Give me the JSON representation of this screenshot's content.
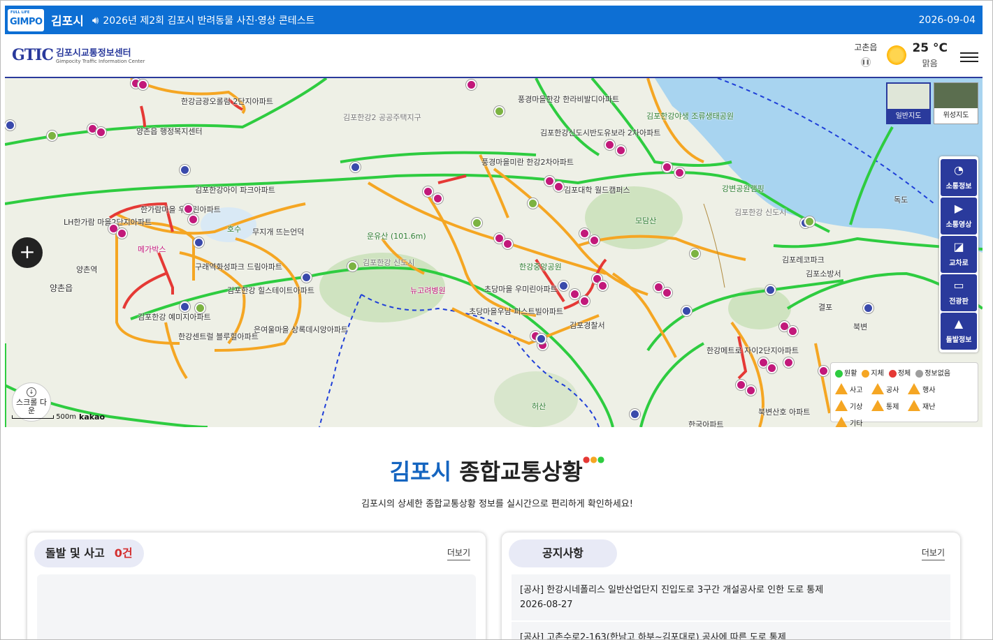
{
  "topbar": {
    "logo_top": "FULL LIFE",
    "logo_main": "GIMPO",
    "city": "김포시",
    "notice": "2026년 제2회 김포시 반려동물 사진·영상 콘테스트",
    "date": "2026-09-04",
    "background": "#0d6fd4"
  },
  "header": {
    "brand_mark": "GTIC",
    "brand_name": "김포시교통정보센터",
    "brand_sub": "Gimpocity Traffic Information Center",
    "weather_area": "고촌읍",
    "temperature": "25 °C",
    "condition": "맑음",
    "icons": [
      "sun-icon",
      "pause-icon",
      "menu-icon"
    ]
  },
  "map": {
    "maptypes": [
      "일반지도",
      "위성지도"
    ],
    "side_buttons": [
      "소통정보",
      "소통영상",
      "교차로",
      "전광판",
      "돌발정보"
    ],
    "zoom_label": "+",
    "scroll_label": "스크롤 다운",
    "scale": "500m",
    "provider": "kakao",
    "legend": {
      "traffic": [
        {
          "label": "원활",
          "color": "#2ecc40"
        },
        {
          "label": "지체",
          "color": "#f5a623"
        },
        {
          "label": "정체",
          "color": "#e53935"
        },
        {
          "label": "정보없음",
          "color": "#9e9e9e"
        }
      ],
      "events": [
        "사고",
        "공사",
        "행사",
        "기상",
        "통제",
        "재난",
        "기타"
      ]
    },
    "places": [
      "한강금광오롤림 2단지아파트",
      "김포한강2 공공주택지구",
      "풍경마을한강 한라비발디아파트",
      "김포한강야생 조류생태공원",
      "양촌읍 행정복지센터",
      "김포한강신도시반도유보라 2차아파트",
      "풍경마을미란 한강2차아파트",
      "김포한강아이 파크아파트",
      "김포대학 월드캠퍼스",
      "강변공원램핑",
      "LH한가람 마을2단지아파트",
      "한가람마을 우미린아파트",
      "호수",
      "무지개 뜨는언덕",
      "메가박스",
      "운유산 (101.6m)",
      "모담산",
      "김포한강 신도시",
      "독도",
      "양촌역",
      "구래역화성파크 드림아파트",
      "김포한강 신도시",
      "김포레코파크",
      "양촌읍",
      "김포한강 힐스테이트아파트",
      "뉴고려병원",
      "한강중앙공원",
      "김포소방서",
      "김포한강 예미지아파트",
      "초당마을 우미린아파트",
      "김포경찰서",
      "초당마을우남 퍼스트빌아파트",
      "은여울마을 상록데시앙아파트",
      "한강센트럴 블루힐아파트",
      "결포",
      "북변",
      "한강메트로 자이2단지아파트",
      "허산",
      "북변산호 아파트",
      "한국아파트"
    ]
  },
  "content": {
    "title_blue": "김포시",
    "title_black": "종합교통상황",
    "subtitle": "김포시의 상세한 종합교통상황 정보를 실시간으로 편리하게 확인하세요!",
    "incidents": {
      "title": "돌발 및 사고",
      "count": "0건",
      "more": "더보기"
    },
    "notices": {
      "title": "공지사항",
      "more": "더보기",
      "items": [
        {
          "title": "[공사] 한강시네폴리스 일반산업단지 진입도로 3구간 개설공사로 인한 도로 통제",
          "date": "2026-08-27"
        },
        {
          "title": "[공사] 고촌수로2-163(한남고 하부~김포대로) 공사에 따른 도로 통제",
          "date": ""
        }
      ]
    }
  }
}
